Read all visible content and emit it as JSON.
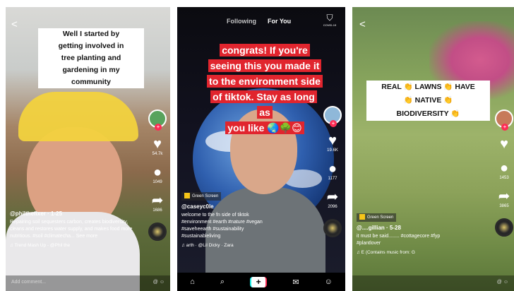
{
  "panel1": {
    "back": "<",
    "caption_lines": [
      "Well I started by",
      "getting involved in",
      "tree planting and",
      "gardening in my",
      "community"
    ],
    "rail_counts": {
      "likes": "54.7k",
      "comments": "1049",
      "shares": "1686"
    },
    "handle": "@philthefixer · 1-25",
    "description": "Repairing soil sequesters carbon, creates biodiversity, cleans and restores water supply, and makes food more nutritious. #soil #climatecha... See more",
    "music": "♫  Trend Mash Up - @Phil the",
    "comment_placeholder": "Add comment..."
  },
  "panel2": {
    "following": "Following",
    "for_you": "For You",
    "covid_label": "COVID-19",
    "caption_lines": [
      "congrats! If you're",
      "seeing this you made it",
      "to the environment side",
      "of tiktok. Stay as long as",
      "you like 🌏🌳😊"
    ],
    "rail_counts": {
      "likes": "19.6K",
      "comments": "1177",
      "shares": "2096"
    },
    "green_screen": "Green Screen",
    "handle": "@caseyc0le",
    "description_lines": [
      "welcome to the fn side of tiktok",
      "#environment #earth #nature #vegan",
      "#saveheearth #sustainability",
      "#sustainableliving"
    ],
    "music": "♫  arth · @Lil Dicky · Zara",
    "nav": {
      "home": "⌂",
      "discover": "⌕",
      "plus": "+",
      "inbox": "✉",
      "me": "☺"
    }
  },
  "panel3": {
    "back": "<",
    "caption_lines": [
      "REAL 👏 LAWNS 👏 HAVE",
      "👏 NATIVE 👏",
      "BIODIVERSITY 👏"
    ],
    "rail_counts": {
      "likes": "",
      "comments": "1453",
      "shares": "3865"
    },
    "green_screen": "Green Screen",
    "handle": "@....gillian · 5-28",
    "description_lines": [
      "it must be said........ #cottagecore #fyp",
      "#plantlover"
    ],
    "music": "♫  E (Contains music from: G"
  }
}
